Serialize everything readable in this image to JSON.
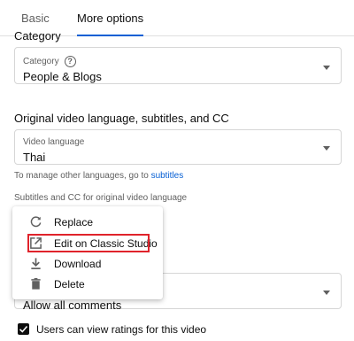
{
  "tabs": [
    {
      "label": "Basic"
    },
    {
      "label": "More options"
    }
  ],
  "category": {
    "header_cut": "Category",
    "label": "Category",
    "value": "People & Blogs"
  },
  "language_section": {
    "title": "Original video language, subtitles, and CC",
    "field_label": "Video language",
    "value": "Thai",
    "manage_text": "To manage other languages, go to",
    "manage_link": "subtitles",
    "subtitles_text": "Subtitles and CC for original video language"
  },
  "menu": {
    "items": [
      {
        "label": "Replace",
        "icon": "replace-icon"
      },
      {
        "label": "Edit on Classic Studio",
        "icon": "open-external-icon"
      },
      {
        "label": "Download",
        "icon": "download-icon"
      },
      {
        "label": "Delete",
        "icon": "trash-icon"
      }
    ]
  },
  "comments": {
    "value": "Allow all comments"
  },
  "ratings": {
    "checked": true,
    "label": "Users can view ratings for this video"
  },
  "colors": {
    "accent": "#065fd4",
    "highlight": "#e0232b"
  }
}
